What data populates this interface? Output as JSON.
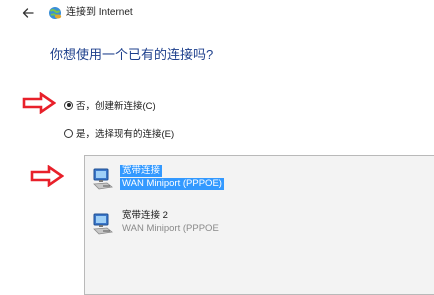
{
  "window": {
    "title": "连接到 Internet",
    "back_icon": "back-arrow-icon",
    "title_icon": "globe-network-icon"
  },
  "question": "你想使用一个已有的连接吗?",
  "options": [
    {
      "label": "否，创建新连接(C)",
      "selected": true
    },
    {
      "label": "是，选择现有的连接(E)",
      "selected": false
    }
  ],
  "connections": [
    {
      "name": "宽带连接",
      "device": "WAN Miniport (PPPOE)",
      "selected": true
    },
    {
      "name": "宽带连接 2",
      "device": "WAN Miniport (PPPOE",
      "selected": false
    }
  ],
  "annotation": {
    "arrow_color": "#e8202a"
  },
  "colors": {
    "question": "#1d3f8c",
    "selection": "#3399ff",
    "list_background": "#f3f3f3"
  }
}
